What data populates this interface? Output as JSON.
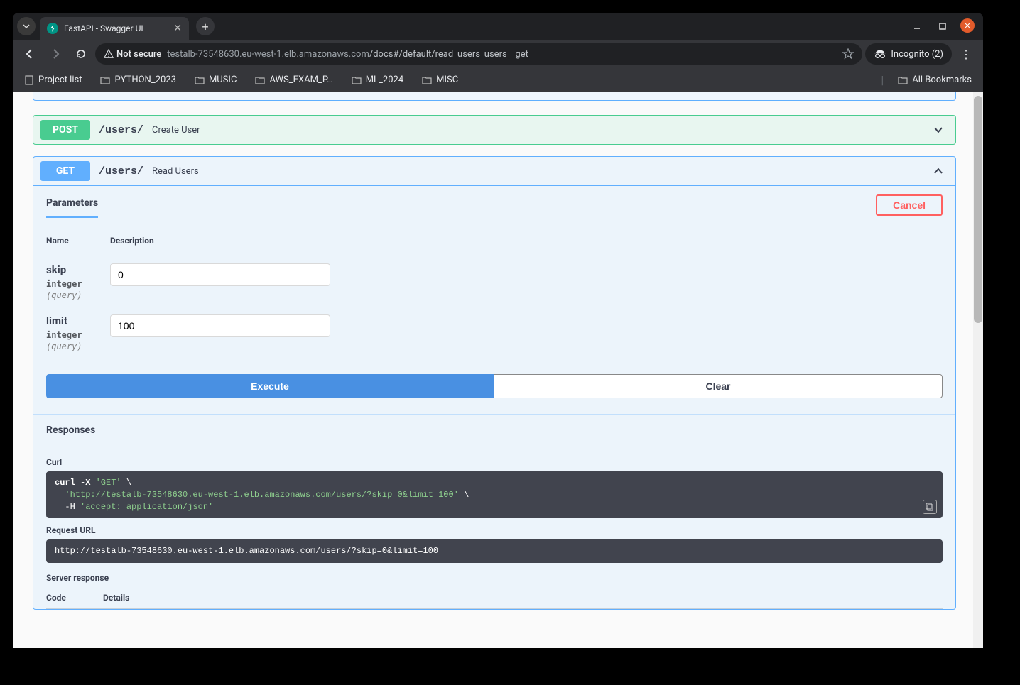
{
  "browser": {
    "tab_title": "FastAPI - Swagger UI",
    "not_secure_label": "Not secure",
    "url_host": "testalb-73548630.eu-west-1.elb.amazonaws.com",
    "url_path": "/docs#/default/read_users_users__get",
    "incognito_label": "Incognito (2)"
  },
  "bookmarks": {
    "items": [
      "Project list",
      "PYTHON_2023",
      "MUSIC",
      "AWS_EXAM_P…",
      "ML_2024",
      "MISC"
    ],
    "all_bookmarks": "All Bookmarks"
  },
  "endpoints": {
    "post_users": {
      "method": "POST",
      "path": "/users/",
      "summary": "Create User"
    },
    "get_users": {
      "method": "GET",
      "path": "/users/",
      "summary": "Read Users"
    }
  },
  "params": {
    "tab_label": "Parameters",
    "cancel_label": "Cancel",
    "header_name": "Name",
    "header_desc": "Description",
    "skip": {
      "name": "skip",
      "type": "integer",
      "in": "(query)",
      "value": "0"
    },
    "limit": {
      "name": "limit",
      "type": "integer",
      "in": "(query)",
      "value": "100"
    },
    "execute_label": "Execute",
    "clear_label": "Clear"
  },
  "responses": {
    "header": "Responses",
    "curl_label": "Curl",
    "curl_line1_a": "curl -X ",
    "curl_line1_b": "'GET'",
    "curl_line1_c": " \\",
    "curl_line2_a": "  ",
    "curl_line2_b": "'http://testalb-73548630.eu-west-1.elb.amazonaws.com/users/?skip=0&limit=100'",
    "curl_line2_c": " \\",
    "curl_line3_a": "  -H ",
    "curl_line3_b": "'accept: application/json'",
    "request_url_label": "Request URL",
    "request_url": "http://testalb-73548630.eu-west-1.elb.amazonaws.com/users/?skip=0&limit=100",
    "server_response_label": "Server response",
    "code_header": "Code",
    "details_header": "Details"
  }
}
